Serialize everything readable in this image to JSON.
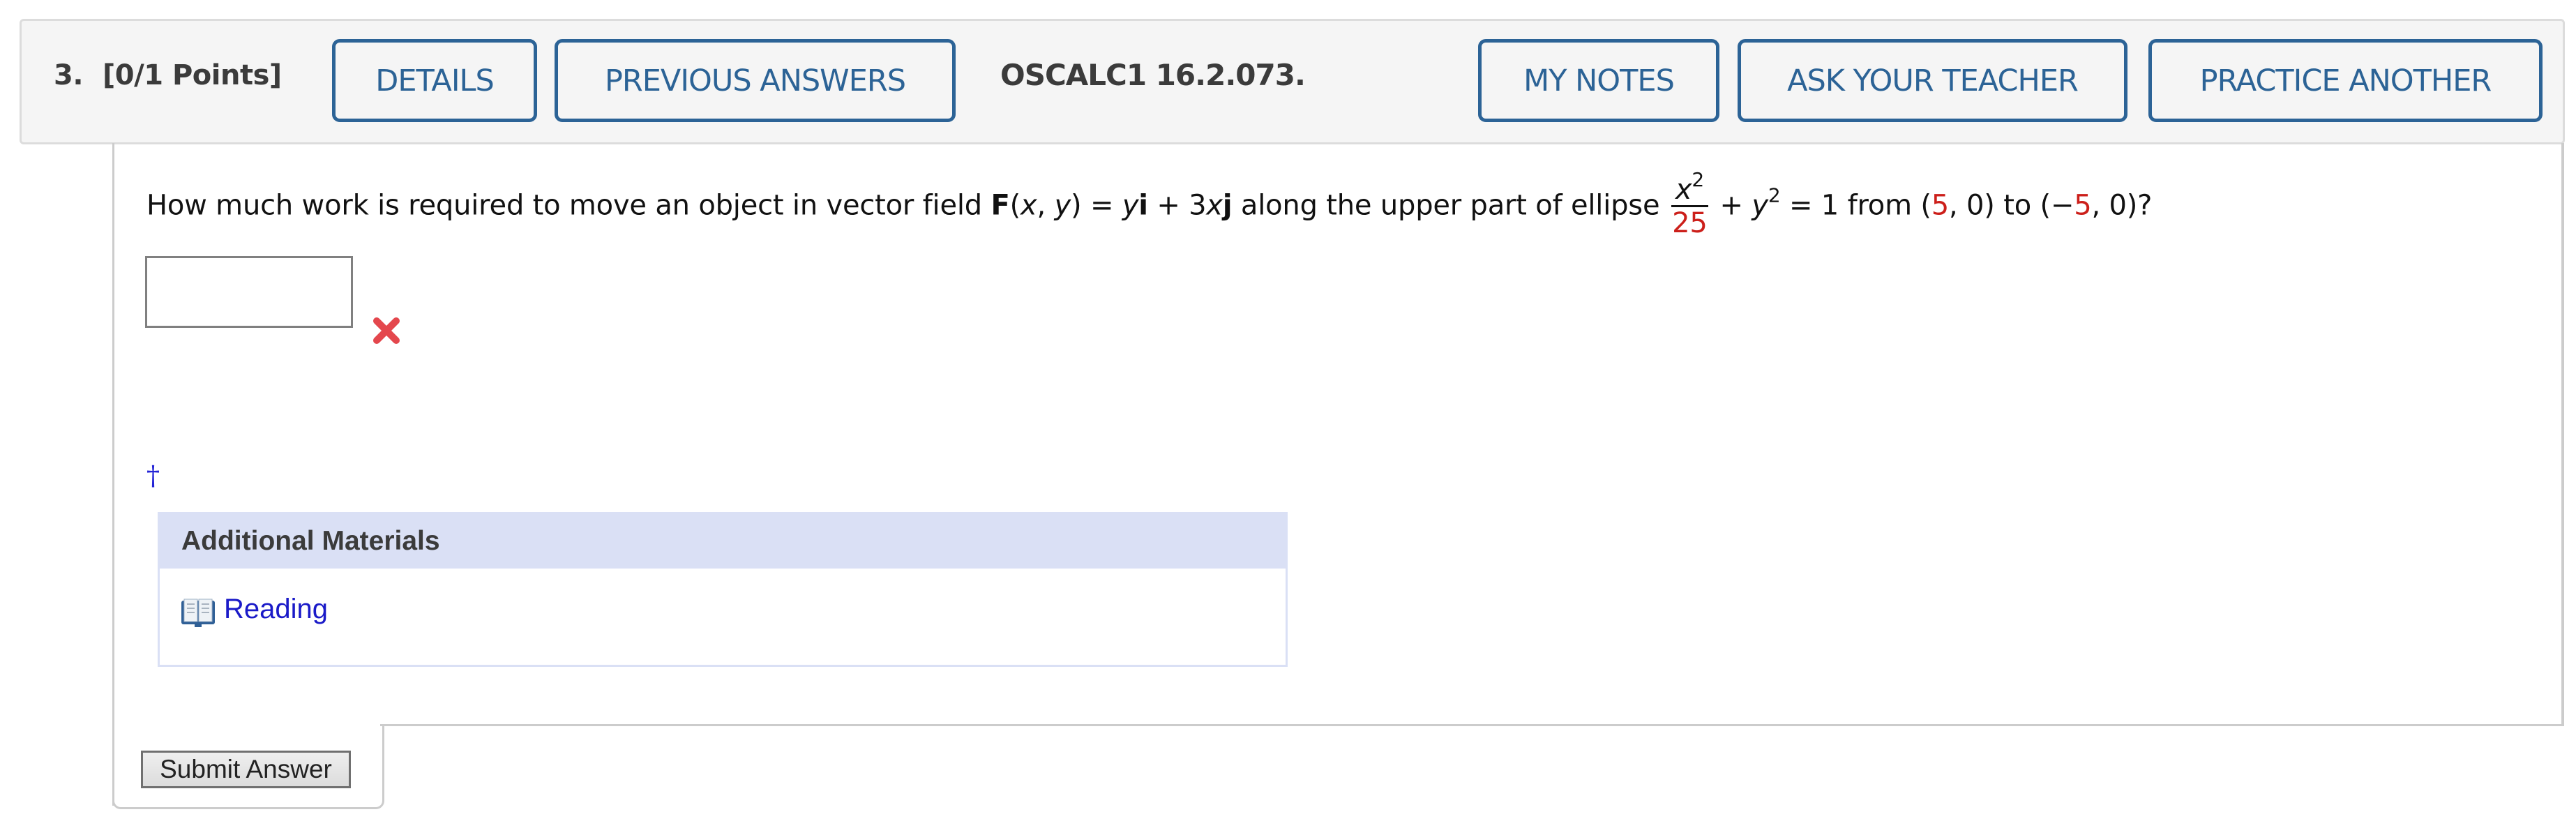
{
  "header": {
    "question_number": "3.",
    "points": "[0/1 Points]",
    "buttons": {
      "details": "DETAILS",
      "previous_answers": "PREVIOUS ANSWERS",
      "my_notes": "MY NOTES",
      "ask_teacher": "ASK YOUR TEACHER",
      "practice_another": "PRACTICE ANOTHER"
    },
    "problem_code": "OSCALC1 16.2.073."
  },
  "question": {
    "part1": "How much work is required to move an object in vector field ",
    "F": "F",
    "args": "(x, y) = ",
    "y": "y",
    "i": "i",
    "plus3x": " + 3",
    "x": "x",
    "j": "j",
    "part2": " along the upper part of ellipse ",
    "frac_num_var": "x",
    "frac_num_exp": "2",
    "frac_den": "25",
    "plus": " + ",
    "y2_var": "y",
    "y2_exp": "2",
    "equals_one_from": " = 1 from (",
    "start_x": "5",
    "start_rest": ", 0) to (−",
    "end_x": "5",
    "end_rest": ", 0)?"
  },
  "answer": {
    "value": "",
    "status_icon": "wrong-x-icon",
    "status_color": "#e0474c"
  },
  "footnote_marker": "†",
  "materials": {
    "title": "Additional Materials",
    "items": [
      {
        "icon": "book-icon",
        "label": "Reading"
      }
    ]
  },
  "submit": {
    "label": "Submit Answer"
  },
  "colors": {
    "accent": "#2c6396",
    "highlight_red": "#cc1f1a",
    "materials_header_bg": "#dae0f5",
    "link": "#1a1ac8"
  }
}
